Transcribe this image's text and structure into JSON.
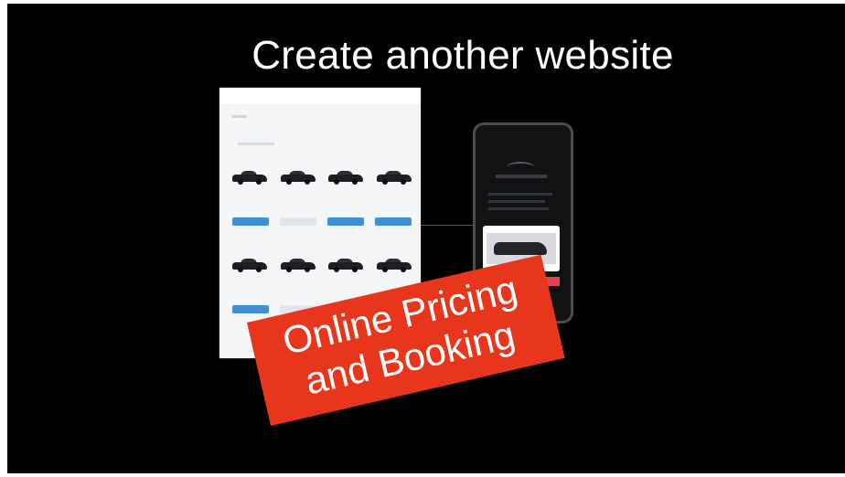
{
  "slide": {
    "title": "Create another website"
  },
  "desktop_mock": {
    "car_rows": 2,
    "cars_per_row": 4
  },
  "sticker": {
    "line1": "Online Pricing",
    "line2": "and Booking",
    "color": "#e8361c"
  },
  "colors": {
    "background": "#000000",
    "accent_blue": "#3e8fd6",
    "accent_red": "#e2454e"
  }
}
